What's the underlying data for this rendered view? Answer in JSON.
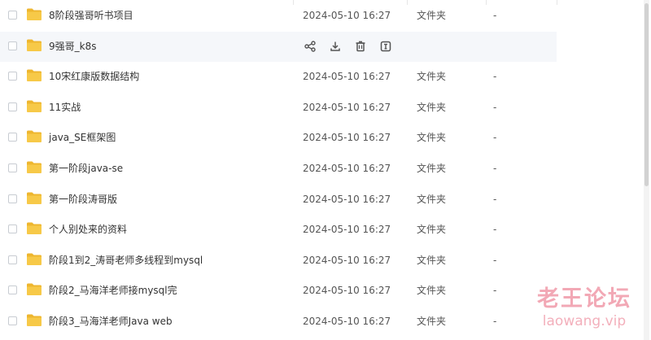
{
  "files": [
    {
      "name": "8阶段强哥听书项目",
      "modified": "2024-05-10 16:27",
      "type": "文件夹",
      "size": "-",
      "hovered": false
    },
    {
      "name": "9强哥_k8s",
      "modified": "",
      "type": "",
      "size": "",
      "hovered": true
    },
    {
      "name": "10宋红康版数据结构",
      "modified": "2024-05-10 16:27",
      "type": "文件夹",
      "size": "-",
      "hovered": false
    },
    {
      "name": "11实战",
      "modified": "2024-05-10 16:27",
      "type": "文件夹",
      "size": "-",
      "hovered": false
    },
    {
      "name": "java_SE框架图",
      "modified": "2024-05-10 16:27",
      "type": "文件夹",
      "size": "-",
      "hovered": false
    },
    {
      "name": "第一阶段java-se",
      "modified": "2024-05-10 16:27",
      "type": "文件夹",
      "size": "-",
      "hovered": false
    },
    {
      "name": "第一阶段涛哥版",
      "modified": "2024-05-10 16:27",
      "type": "文件夹",
      "size": "-",
      "hovered": false
    },
    {
      "name": "个人别处来的资料",
      "modified": "2024-05-10 16:27",
      "type": "文件夹",
      "size": "-",
      "hovered": false
    },
    {
      "name": "阶段1到2_涛哥老师多线程到mysql",
      "modified": "2024-05-10 16:27",
      "type": "文件夹",
      "size": "-",
      "hovered": false
    },
    {
      "name": "阶段2_马海洋老师接mysql完",
      "modified": "2024-05-10 16:27",
      "type": "文件夹",
      "size": "-",
      "hovered": false
    },
    {
      "name": "阶段3_马海洋老师Java web",
      "modified": "2024-05-10 16:27",
      "type": "文件夹",
      "size": "-",
      "hovered": false
    }
  ],
  "row_actions": [
    {
      "icon": "share-icon"
    },
    {
      "icon": "download-icon"
    },
    {
      "icon": "delete-icon"
    },
    {
      "icon": "rename-icon"
    }
  ],
  "colors": {
    "folder": "#f7c948",
    "folder_dark": "#eeb62f",
    "hover_bg": "#f5f7fa",
    "icon": "#555555",
    "watermark": "#e86078"
  },
  "watermark": {
    "title": "老王论坛",
    "url": "laowang.vip"
  }
}
